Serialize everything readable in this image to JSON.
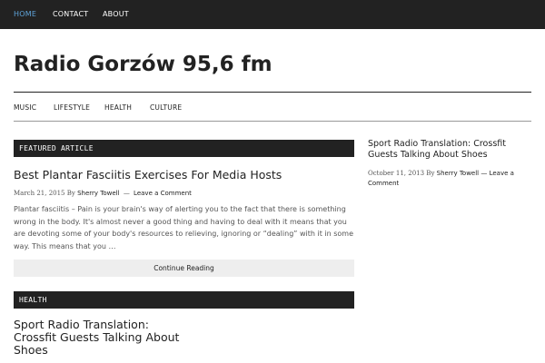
{
  "top_nav": {
    "home": "HOME",
    "contact": "CONTACT",
    "about": "ABOUT"
  },
  "site": {
    "title": "Radio Gorzów 95,6 fm"
  },
  "category_nav": {
    "music": "MUSIC",
    "lifestyle": "LIFESTYLE",
    "health": "HEALTH",
    "culture": "CULTURE"
  },
  "featured": {
    "section_label": "FEATURED ARTICLE",
    "title": "Best Plantar Fasciitis Exercises For Media Hosts",
    "date": "March 21, 2015",
    "by": "By",
    "author": "Sherry Towell",
    "separator": "—",
    "comment_link": "Leave a Comment",
    "excerpt": "Plantar fasciitis – Pain is your brain's way of alerting you to the fact that there is something wrong in the body. It's almost never a good thing and having to deal with it means that you are devoting some of your body's resources to relieving, ignoring or “dealing” with it in some way. This means that you …",
    "continue_label": "Continue Reading"
  },
  "health_section": {
    "section_label": "HEALTH",
    "title_line1": "Sport Radio Translation:",
    "title_line2": "Crossfit Guests Talking About",
    "title_line3": "Shoes"
  },
  "sidebar": {
    "title": "Sport Radio Translation: Crossfit Guests Talking About Shoes",
    "date": "October 11, 2013",
    "by": "By",
    "author": "Sherry Towell",
    "separator": "—",
    "comment_link": "Leave a Comment"
  },
  "colors": {
    "nav_bg": "#222222",
    "active_link": "#5ea3d9",
    "button_bg": "#eeeeee"
  }
}
